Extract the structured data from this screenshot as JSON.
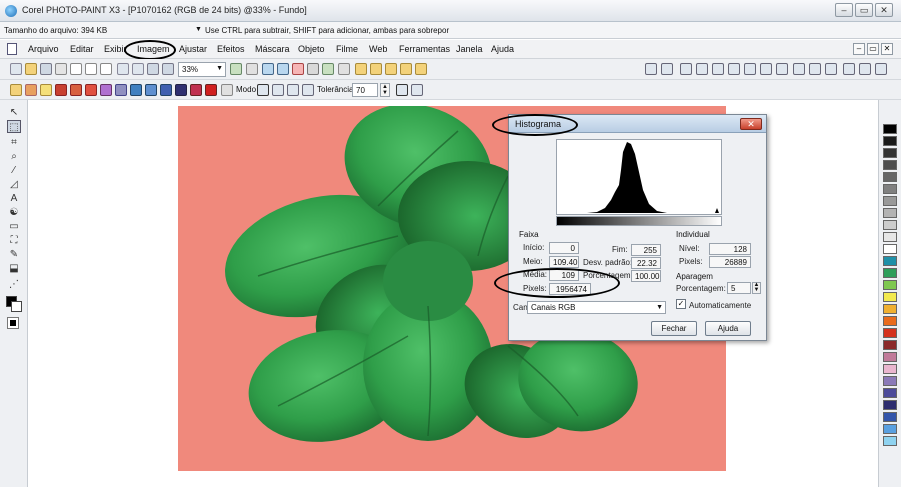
{
  "window": {
    "title": "Corel PHOTO-PAINT X3 - [P1070162 (RGB de 24 bits) @33% - Fundo]",
    "controls": [
      "‒",
      "▭",
      "✕"
    ]
  },
  "hint_bar": {
    "file_size": "Tamanho do arquivo: 394 KB",
    "hint": "Use CTRL para subtrair, SHIFT para adicionar, ambas para sobrepor"
  },
  "menu": {
    "items": [
      "Arquivo",
      "Editar",
      "Exibir",
      "Imagem",
      "Ajustar",
      "Efeitos",
      "Máscara",
      "Objeto",
      "Filme",
      "Web",
      "Ferramentas",
      "Janela",
      "Ajuda"
    ],
    "mdi_controls": [
      "‒",
      "▭",
      "✕"
    ]
  },
  "toolbar": {
    "zoom": "33%",
    "mode_label": "Modo",
    "tolerance_label": "Tolerância",
    "tolerance_value": "70"
  },
  "histogram_dialog": {
    "title": "Histograma",
    "range_group": "Faixa",
    "inicio_label": "Início:",
    "inicio_value": "0",
    "fim_label": "Fim:",
    "fim_value": "255",
    "meio_label": "Meio:",
    "meio_value": "109.40",
    "desv_label": "Desv. padrão:",
    "desv_value": "22.32",
    "media_label": "Média:",
    "media_value": "109",
    "porcentagem_label": "Porcentagem:",
    "porcentagem_value": "100.00",
    "pixels_label": "Pixels:",
    "pixels_value": "1956474",
    "individual_group": "Individual",
    "nivel_label": "Nível:",
    "nivel_value": "128",
    "ind_pixels_label": "Pixels:",
    "ind_pixels_value": "26889",
    "aparagem_group": "Aparagem",
    "aparagem_pct_label": "Porcentagem:",
    "aparagem_pct_value": "5",
    "auto_label": "Automaticamente",
    "auto_checked": true,
    "canal_label": "Canal:",
    "canal_value": "Canais RGB",
    "close_button": "Fechar",
    "help_button": "Ajuda"
  },
  "colors": {
    "canvas_background": "#f0897c",
    "leaf_green": "#2f9e49",
    "leaf_dark": "#1b6b30"
  },
  "palette": [
    "#000000",
    "#1a1a1a",
    "#333333",
    "#4d4d4d",
    "#666666",
    "#808080",
    "#999999",
    "#b3b3b3",
    "#cccccc",
    "#e6e6e6",
    "#ffffff",
    "#1e90a8",
    "#2e9e5a",
    "#7ec850",
    "#f2e94e",
    "#f0b030",
    "#e86a1c",
    "#d4311d",
    "#8b2a2a",
    "#c07a9a",
    "#e9b6cf",
    "#8a7ab8",
    "#4b4a9a",
    "#2c2c6e",
    "#3355aa",
    "#5aa0e0",
    "#8fd3f0"
  ]
}
